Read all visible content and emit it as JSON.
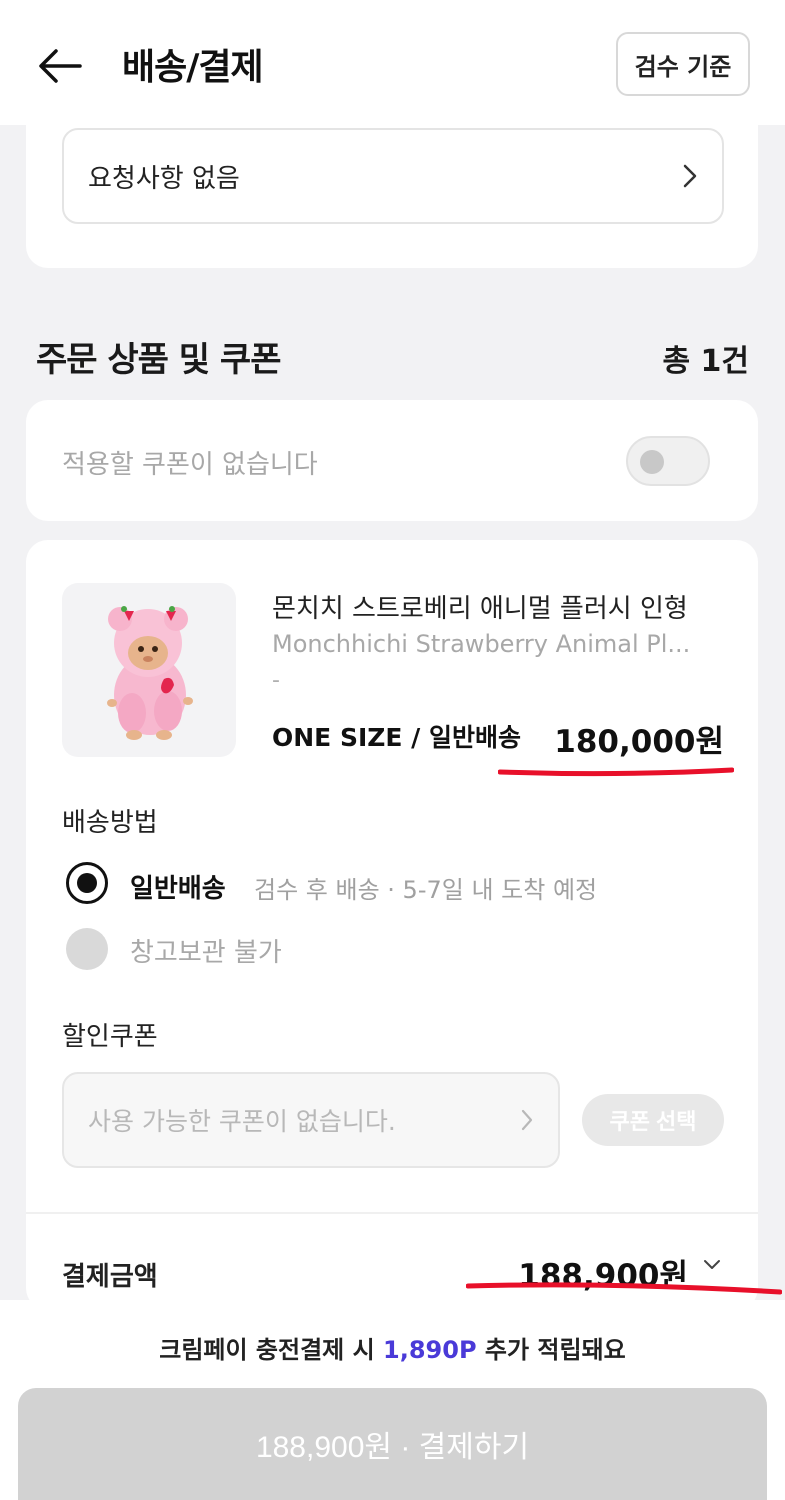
{
  "header": {
    "title": "배송/결제",
    "inspect_button": "검수 기준"
  },
  "request": {
    "text": "요청사항 없음"
  },
  "order_section": {
    "title": "주문 상품 및 쿠폰",
    "count": "총 1건"
  },
  "coupon_toggle": {
    "text": "적용할 쿠폰이 없습니다",
    "enabled": false
  },
  "product": {
    "name_ko": "몬치치 스트로베리 애니멀 플러시 인형",
    "name_en": "Monchhichi Strawberry Animal Pl...",
    "dash": "-",
    "option": "ONE SIZE / 일반배송",
    "price": "180,000원"
  },
  "shipping": {
    "label": "배송방법",
    "options": [
      {
        "name": "일반배송",
        "desc": "검수 후 배송 · 5-7일 내 도착 예정",
        "selected": true
      },
      {
        "name": "창고보관 불가",
        "desc": "",
        "selected": false
      }
    ]
  },
  "discount": {
    "label": "할인쿠폰",
    "placeholder": "사용 가능한 쿠폰이 없습니다.",
    "select_button": "쿠폰 선택"
  },
  "payment": {
    "label": "결제금액",
    "amount": "188,900원"
  },
  "reward": {
    "prefix": "크림페이 충전결제 시 ",
    "points": "1,890P",
    "suffix": " 추가 적립돼요"
  },
  "pay_button": "188,900원 · 결제하기",
  "colors": {
    "accent_points": "#4a3ad8",
    "annotation_red": "#e8102a",
    "disabled_button": "#d2d2d2"
  }
}
